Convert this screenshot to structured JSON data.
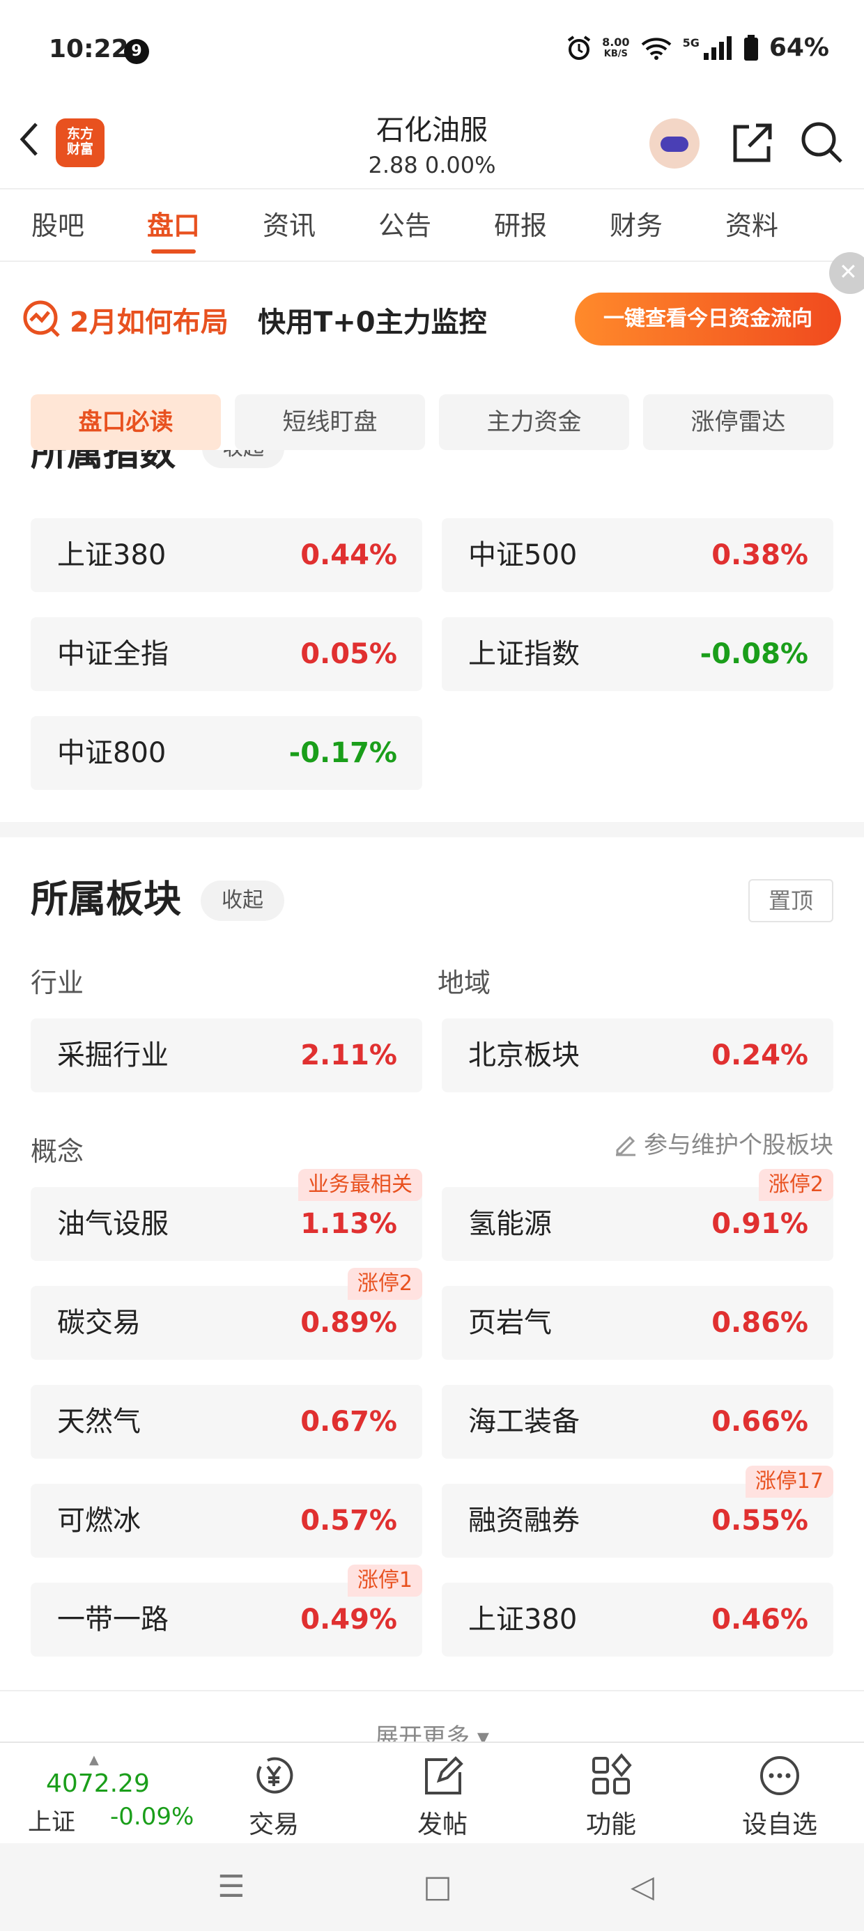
{
  "status": {
    "time": "10:22",
    "notif_count": "9",
    "speed_value": "8.00",
    "speed_unit": "KB/S",
    "network": "5G",
    "battery": "64%"
  },
  "header": {
    "stock_name": "石化油服",
    "price_line": "2.88  0.00%",
    "logo_text_1": "东方",
    "logo_text_2": "财富"
  },
  "tabs": [
    "股吧",
    "盘口",
    "资讯",
    "公告",
    "研报",
    "财务",
    "资料"
  ],
  "active_tab": 1,
  "banner": {
    "title_orange": "2月如何布局",
    "title_black": "快用T+0主力监控",
    "button": "一键查看今日资金流向",
    "close": "✕"
  },
  "subtabs": [
    "盘口必读",
    "短线盯盘",
    "主力资金",
    "涨停雷达"
  ],
  "index_section": {
    "title": "所属指数",
    "collapse": "收起",
    "items": [
      {
        "name": "上证380",
        "pct": "0.44%",
        "dir": "up"
      },
      {
        "name": "中证500",
        "pct": "0.38%",
        "dir": "up"
      },
      {
        "name": "中证全指",
        "pct": "0.05%",
        "dir": "up"
      },
      {
        "name": "上证指数",
        "pct": "-0.08%",
        "dir": "down"
      },
      {
        "name": "中证800",
        "pct": "-0.17%",
        "dir": "down"
      }
    ]
  },
  "sector_section": {
    "title": "所属板块",
    "collapse": "收起",
    "pin": "置顶",
    "industry_label": "行业",
    "region_label": "地域",
    "industry": {
      "name": "采掘行业",
      "pct": "2.11%"
    },
    "region": {
      "name": "北京板块",
      "pct": "0.24%"
    },
    "concept_label": "概念",
    "maintain": "参与维护个股板块",
    "concepts": [
      {
        "name": "油气设服",
        "pct": "1.13%",
        "tag": "业务最相关"
      },
      {
        "name": "氢能源",
        "pct": "0.91%",
        "tag": "涨停2"
      },
      {
        "name": "碳交易",
        "pct": "0.89%",
        "tag": "涨停2"
      },
      {
        "name": "页岩气",
        "pct": "0.86%",
        "tag": ""
      },
      {
        "name": "天然气",
        "pct": "0.67%",
        "tag": ""
      },
      {
        "name": "海工装备",
        "pct": "0.66%",
        "tag": ""
      },
      {
        "name": "可燃冰",
        "pct": "0.57%",
        "tag": ""
      },
      {
        "name": "融资融券",
        "pct": "0.55%",
        "tag": "涨停17"
      },
      {
        "name": "一带一路",
        "pct": "0.49%",
        "tag": "涨停1"
      },
      {
        "name": "上证380",
        "pct": "0.46%",
        "tag": ""
      }
    ],
    "more": "展开更多 ▾"
  },
  "bottom": {
    "index_value": "4072.29",
    "index_name": "上证",
    "index_pct": "-0.09%",
    "caret": "▲",
    "items": [
      {
        "label": "交易",
        "icon": "yen-circle-icon"
      },
      {
        "label": "发帖",
        "icon": "edit-icon"
      },
      {
        "label": "功能",
        "icon": "grid-icon"
      },
      {
        "label": "设自选",
        "icon": "more-icon"
      }
    ]
  },
  "nav": {
    "menu": "☰",
    "home": "□",
    "back": "◁"
  },
  "colors": {
    "accent": "#e8511f",
    "up": "#e03030",
    "down": "#1a9e1a"
  }
}
